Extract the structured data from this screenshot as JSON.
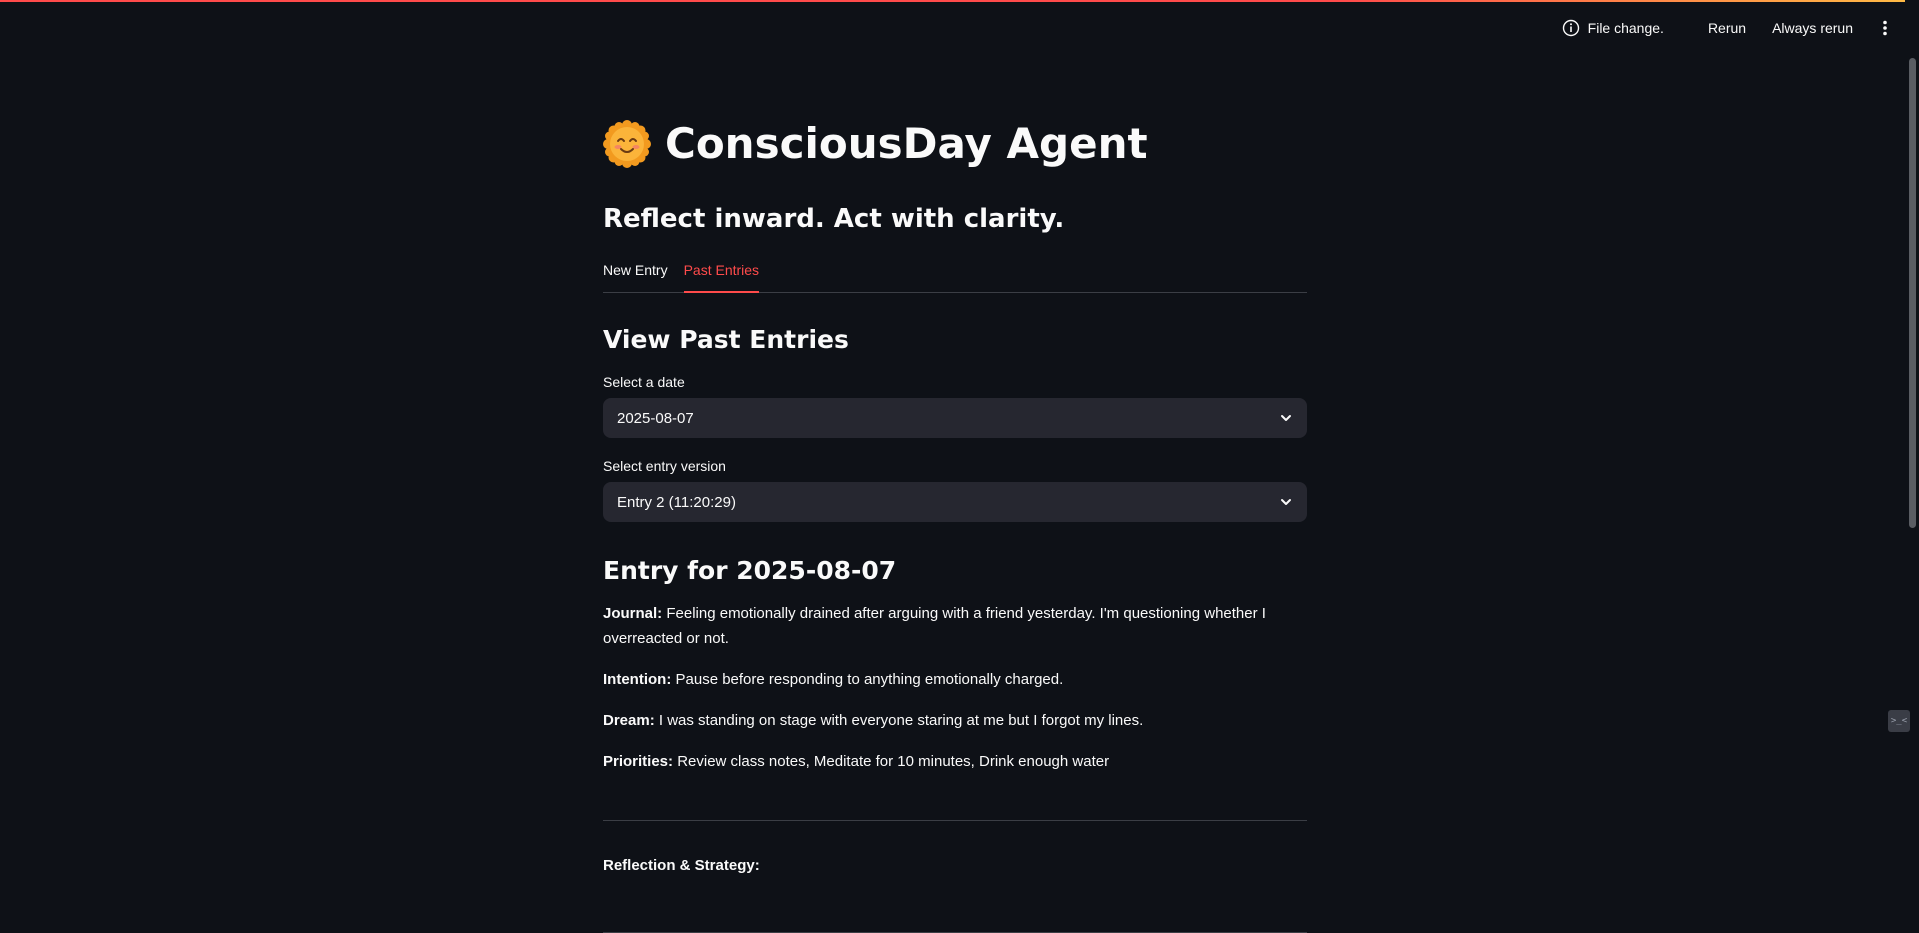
{
  "colors": {
    "background": "#0e1117",
    "accent": "#ff4b4b",
    "select_bg": "#262730",
    "text": "#fafafa"
  },
  "toolbar": {
    "status_icon": "info-icon",
    "status_text": "File change.",
    "rerun_label": "Rerun",
    "always_rerun_label": "Always rerun",
    "menu_icon": "kebab-menu-icon"
  },
  "app": {
    "title_icon": "smiling-sun-icon",
    "title": "ConsciousDay Agent",
    "subtitle": "Reflect inward. Act with clarity."
  },
  "tabs": [
    {
      "label": "New Entry",
      "active": false
    },
    {
      "label": "Past Entries",
      "active": true
    }
  ],
  "past_entries": {
    "heading": "View Past Entries",
    "date_select": {
      "label": "Select a date",
      "value": "2025-08-07"
    },
    "version_select": {
      "label": "Select entry version",
      "value": "Entry 2 (11:20:29)"
    }
  },
  "entry": {
    "heading": "Entry for 2025-08-07",
    "journal_label": "Journal:",
    "journal_text": "Feeling emotionally drained after arguing with a friend yesterday. I'm questioning whether I overreacted or not.",
    "intention_label": "Intention:",
    "intention_text": "Pause before responding to anything emotionally charged.",
    "dream_label": "Dream:",
    "dream_text": "I was standing on stage with everyone staring at me but I forgot my lines.",
    "priorities_label": "Priorities:",
    "priorities_text": "Review class notes, Meditate for 10 minutes, Drink enough water",
    "reflection_label": "Reflection & Strategy:"
  },
  "side_widget": {
    "icon": "code-toggle-icon",
    "text": ">_<"
  }
}
